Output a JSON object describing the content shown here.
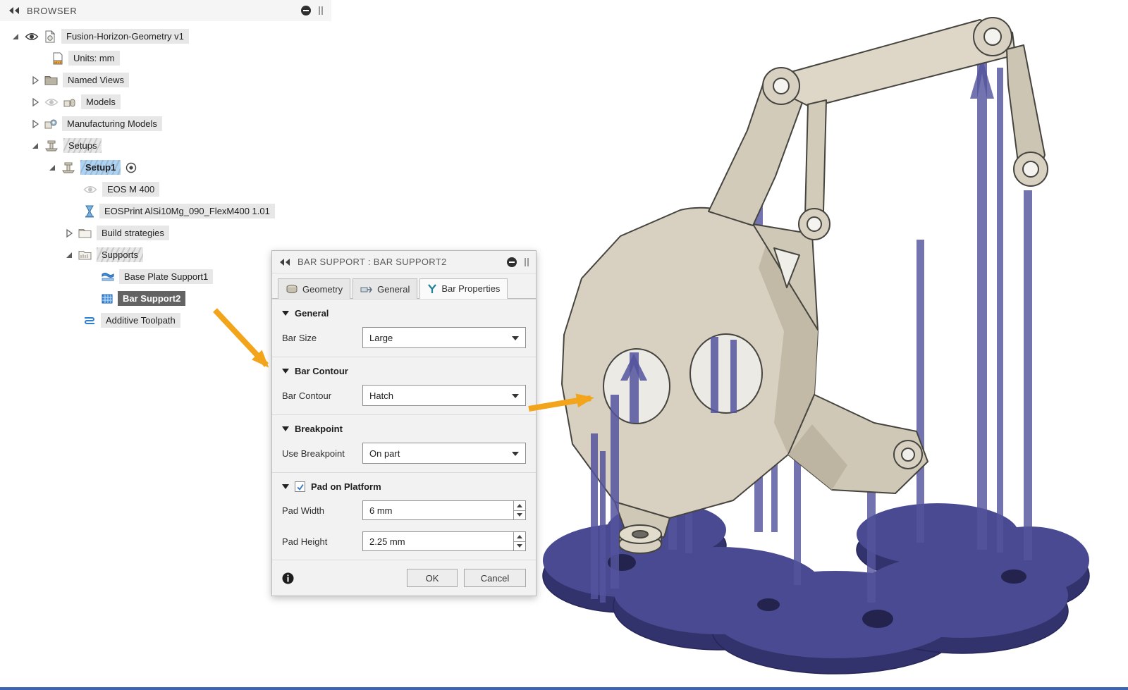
{
  "colors": {
    "accent_orange": "#F2A41B",
    "selection_blue": "#AED2F2",
    "selection_dark": "#636363",
    "support_blue": "#54549E",
    "base_plate_blue": "#4A4A92",
    "part_tan": "#D8D1C1"
  },
  "browser": {
    "title": "BROWSER",
    "tree": [
      {
        "label": "Fusion-Horizon-Geometry v1"
      },
      {
        "label": "Units: mm"
      },
      {
        "label": "Named Views"
      },
      {
        "label": "Models"
      },
      {
        "label": "Manufacturing Models"
      },
      {
        "label": "Setups"
      },
      {
        "label": "Setup1"
      },
      {
        "label": "EOS M 400"
      },
      {
        "label": "EOSPrint AlSi10Mg_090_FlexM400 1.01"
      },
      {
        "label": "Build strategies"
      },
      {
        "label": "Supports"
      },
      {
        "label": "Base Plate Support1"
      },
      {
        "label": "Bar Support2"
      },
      {
        "label": "Additive Toolpath"
      }
    ]
  },
  "dialog": {
    "title": "BAR SUPPORT : BAR SUPPORT2",
    "tabs": [
      {
        "label": "Geometry"
      },
      {
        "label": "General"
      },
      {
        "label": "Bar Properties"
      }
    ],
    "active_tab": "Bar Properties",
    "sections": [
      {
        "header": "General",
        "rows": [
          {
            "label": "Bar Size",
            "value": "Large",
            "control": "dropdown"
          }
        ]
      },
      {
        "header": "Bar Contour",
        "rows": [
          {
            "label": "Bar Contour",
            "value": "Hatch",
            "control": "dropdown"
          }
        ]
      },
      {
        "header": "Breakpoint",
        "rows": [
          {
            "label": "Use Breakpoint",
            "value": "On part",
            "control": "dropdown"
          }
        ]
      },
      {
        "header": "Pad on Platform",
        "checkbox": true,
        "checked": true,
        "rows": [
          {
            "label": "Pad Width",
            "value": "6 mm",
            "control": "stepper"
          },
          {
            "label": "Pad Height",
            "value": "2.25 mm",
            "control": "stepper"
          }
        ]
      }
    ],
    "footer": {
      "ok": "OK",
      "cancel": "Cancel"
    }
  }
}
